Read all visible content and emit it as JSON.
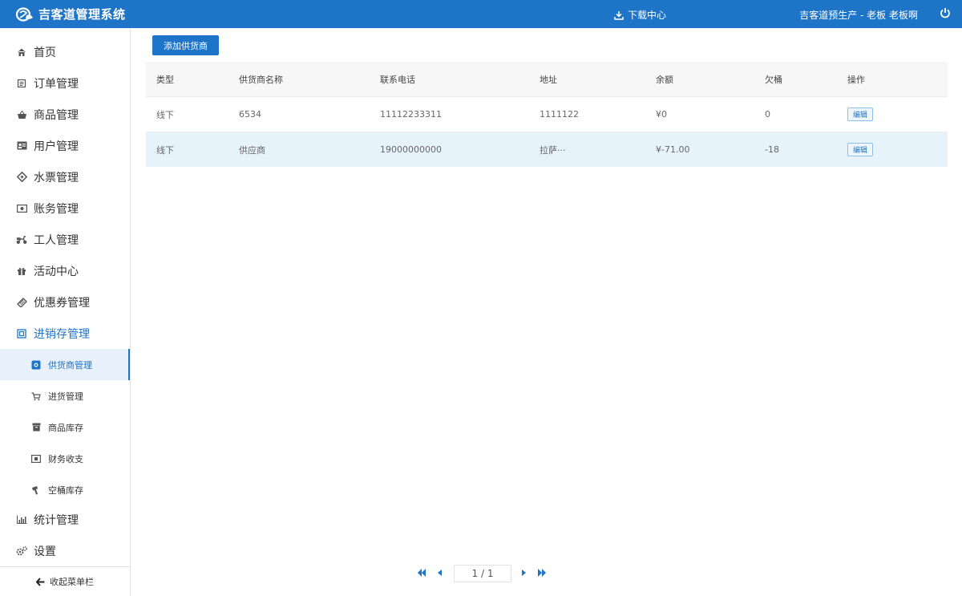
{
  "header": {
    "app_title": "吉客道管理系统",
    "download_label": "下载中心",
    "user_text": "吉客道预生产 - 老板  老板啊",
    "brand_color": "#1e74c6"
  },
  "sidebar": {
    "items": [
      {
        "label": "首页",
        "icon": "home-icon"
      },
      {
        "label": "订单管理",
        "icon": "order-icon"
      },
      {
        "label": "商品管理",
        "icon": "basket-icon"
      },
      {
        "label": "用户管理",
        "icon": "user-card-icon"
      },
      {
        "label": "水票管理",
        "icon": "ticket-icon"
      },
      {
        "label": "账务管理",
        "icon": "money-icon"
      },
      {
        "label": "工人管理",
        "icon": "scooter-icon"
      },
      {
        "label": "活动中心",
        "icon": "gift-icon"
      },
      {
        "label": "优惠券管理",
        "icon": "coupon-icon"
      },
      {
        "label": "进销存管理",
        "icon": "inventory-icon"
      }
    ],
    "sub_items": [
      {
        "label": "供货商管理",
        "icon": "supplier-icon"
      },
      {
        "label": "进货管理",
        "icon": "cart-icon"
      },
      {
        "label": "商品库存",
        "icon": "box-icon"
      },
      {
        "label": "财务收支",
        "icon": "finance-icon"
      },
      {
        "label": "空桶库存",
        "icon": "bucket-icon"
      }
    ],
    "bottom_items": [
      {
        "label": "统计管理",
        "icon": "chart-icon"
      },
      {
        "label": "设置",
        "icon": "settings-icon"
      }
    ],
    "collapse_label": "收起菜单栏"
  },
  "main": {
    "add_button": "添加供货商",
    "columns": [
      "类型",
      "供货商名称",
      "联系电话",
      "地址",
      "余额",
      "欠桶",
      "操作"
    ],
    "rows": [
      {
        "type": "线下",
        "name": "6534",
        "phone": "11112233311",
        "address": "1111122",
        "balance": "¥0",
        "owed": "0",
        "action": "编辑"
      },
      {
        "type": "线下",
        "name": "供应商",
        "phone": "19000000000",
        "address": "拉萨···",
        "balance": "¥-71.00",
        "owed": "-18",
        "action": "编辑"
      }
    ]
  },
  "pagination": {
    "page_text": "1 / 1"
  }
}
